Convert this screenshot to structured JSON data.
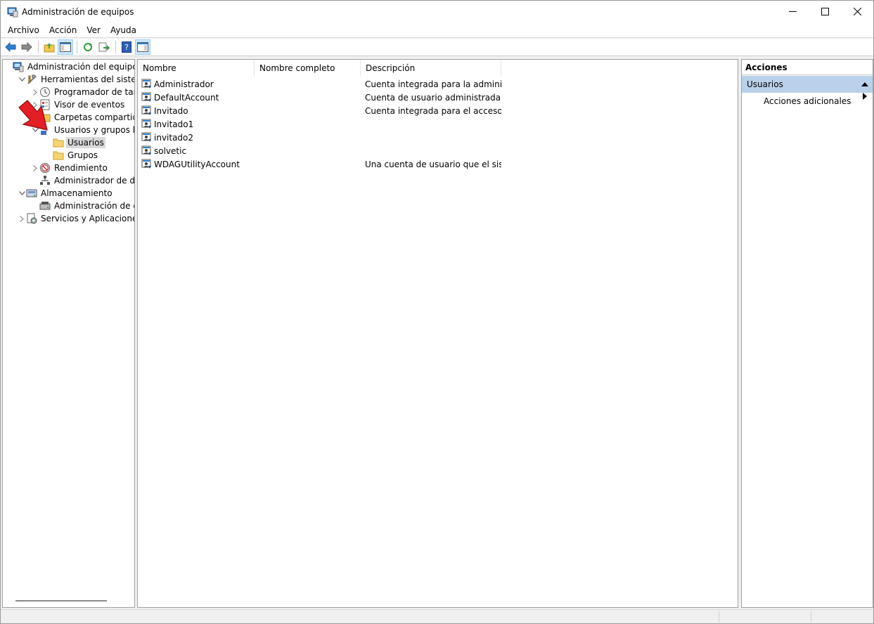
{
  "window": {
    "title": "Administración de equipos"
  },
  "menu": [
    "Archivo",
    "Acción",
    "Ver",
    "Ayuda"
  ],
  "tree": [
    {
      "label": "Administración del equipo (loc",
      "indent": 0,
      "expander": "",
      "icon": "computer-management-icon",
      "selected": false
    },
    {
      "label": "Herramientas del sistema",
      "indent": 1,
      "expander": "down",
      "icon": "tools-icon",
      "selected": false
    },
    {
      "label": "Programador de tareas",
      "indent": 2,
      "expander": "right",
      "icon": "clock-icon",
      "selected": false
    },
    {
      "label": "Visor de eventos",
      "indent": 2,
      "expander": "right",
      "icon": "event-viewer-icon",
      "selected": false
    },
    {
      "label": "Carpetas compartidas",
      "indent": 2,
      "expander": "right",
      "icon": "shared-folder-icon",
      "selected": false
    },
    {
      "label": "Usuarios y grupos locale",
      "indent": 2,
      "expander": "down",
      "icon": "users-groups-icon",
      "selected": false
    },
    {
      "label": "Usuarios",
      "indent": 3,
      "expander": "",
      "icon": "folder-icon",
      "selected": true
    },
    {
      "label": "Grupos",
      "indent": 3,
      "expander": "",
      "icon": "folder-icon",
      "selected": false
    },
    {
      "label": "Rendimiento",
      "indent": 2,
      "expander": "right",
      "icon": "performance-icon",
      "selected": false
    },
    {
      "label": "Administrador de dispo",
      "indent": 2,
      "expander": "",
      "icon": "device-manager-icon",
      "selected": false
    },
    {
      "label": "Almacenamiento",
      "indent": 1,
      "expander": "down",
      "icon": "storage-icon",
      "selected": false
    },
    {
      "label": "Administración de disco",
      "indent": 2,
      "expander": "",
      "icon": "disk-icon",
      "selected": false
    },
    {
      "label": "Servicios y Aplicaciones",
      "indent": 1,
      "expander": "right",
      "icon": "services-icon",
      "selected": false
    }
  ],
  "list": {
    "columns": [
      "Nombre",
      "Nombre completo",
      "Descripción"
    ],
    "rows": [
      {
        "name": "Administrador",
        "full_name": "",
        "description": "Cuenta integrada para la administ..."
      },
      {
        "name": "DefaultAccount",
        "full_name": "",
        "description": "Cuenta de usuario administrada p..."
      },
      {
        "name": "Invitado",
        "full_name": "",
        "description": "Cuenta integrada para el acceso c..."
      },
      {
        "name": "Invitado1",
        "full_name": "",
        "description": ""
      },
      {
        "name": "invitado2",
        "full_name": "",
        "description": ""
      },
      {
        "name": "solvetic",
        "full_name": "",
        "description": ""
      },
      {
        "name": "WDAGUtilityAccount",
        "full_name": "",
        "description": "Una cuenta de usuario que el siste..."
      }
    ]
  },
  "actions": {
    "header": "Acciones",
    "section": "Usuarios",
    "items": [
      "Acciones adicionales"
    ]
  },
  "colors": {
    "selection": "#d9d9d9",
    "actions_section": "#b9d1ea",
    "annotation_arrow": "#e31e24"
  }
}
